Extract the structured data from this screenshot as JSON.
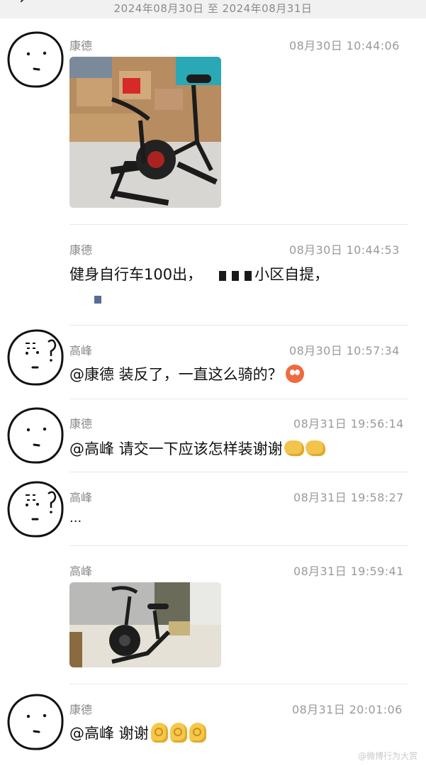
{
  "header": {
    "date_range": "2024年08月30日 至 2024年08月31日"
  },
  "messages": [
    {
      "sender": "康德",
      "time": "08月30日 10:44:06"
    },
    {
      "sender": "康德",
      "time": "08月30日 10:44:53",
      "text_a": "健身自行车100出，",
      "text_b": "小区自提，"
    },
    {
      "sender": "高峰",
      "time": "08月30日 10:57:34",
      "text": "@康德 装反了，一直这么骑的？"
    },
    {
      "sender": "康德",
      "time": "08月31日 19:56:14",
      "text": "@高峰 请交一下应该怎样装谢谢"
    },
    {
      "sender": "高峰",
      "time": "08月31日 19:58:27",
      "text": "..."
    },
    {
      "sender": "高峰",
      "time": "08月31日 19:59:41"
    },
    {
      "sender": "康德",
      "time": "08月31日 20:01:06",
      "text": "@高峰 谢谢"
    }
  ],
  "watermark": "@微博行为大赏",
  "colors": {
    "header_bg": "#f1f1f1",
    "name": "#888888",
    "time": "#9a9a9a"
  },
  "icons": [
    "back-chevron-icon",
    "doodle-avatar",
    "emoji-hot-face-icon",
    "handshake-icon",
    "ok-hand-icon"
  ]
}
